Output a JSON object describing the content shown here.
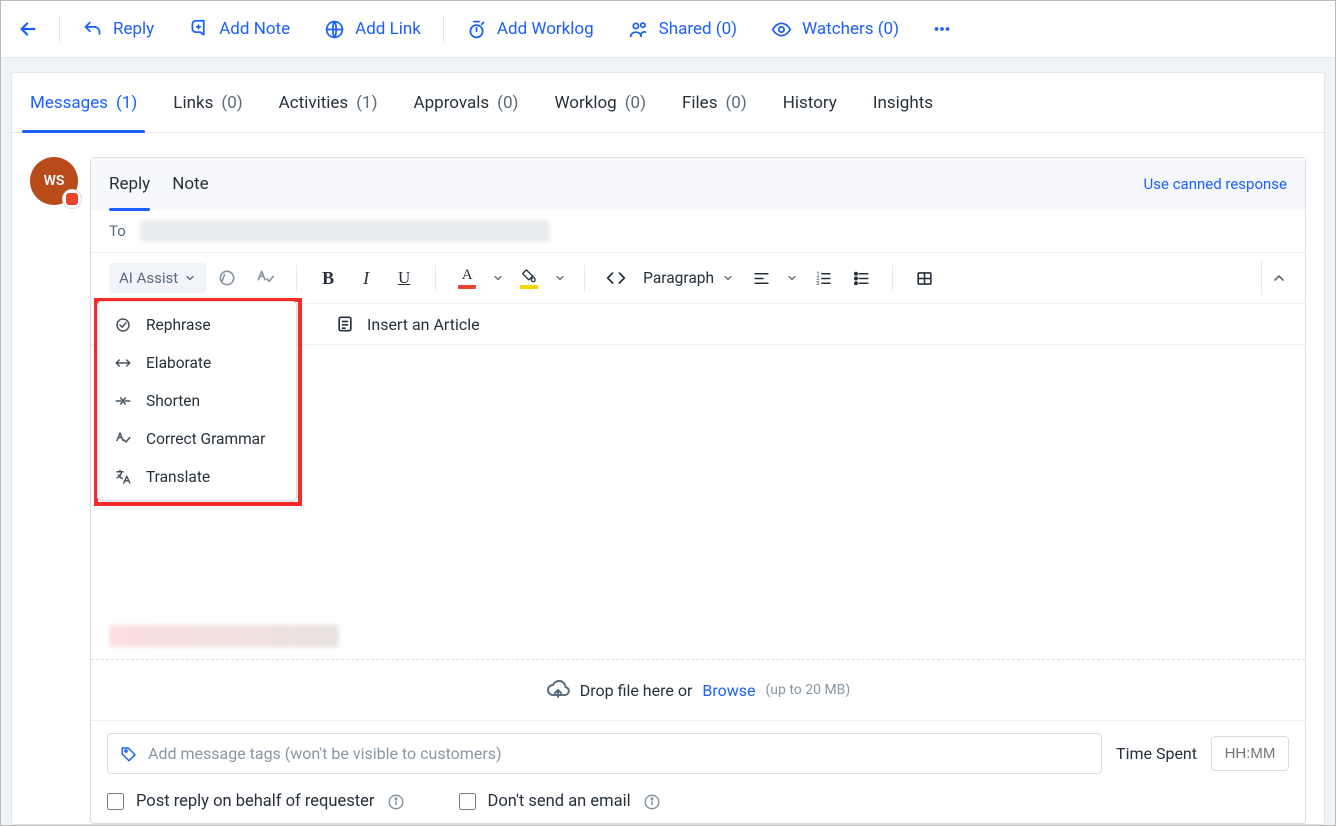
{
  "topbar": {
    "reply": "Reply",
    "add_note": "Add Note",
    "add_link": "Add Link",
    "add_worklog": "Add Worklog",
    "shared": "Shared (0)",
    "watchers": "Watchers (0)"
  },
  "tabs": [
    {
      "label": "Messages",
      "count": "(1)",
      "active": true
    },
    {
      "label": "Links",
      "count": "(0)"
    },
    {
      "label": "Activities",
      "count": "(1)"
    },
    {
      "label": "Approvals",
      "count": "(0)"
    },
    {
      "label": "Worklog",
      "count": "(0)"
    },
    {
      "label": "Files",
      "count": "(0)"
    },
    {
      "label": "History",
      "count": ""
    },
    {
      "label": "Insights",
      "count": ""
    }
  ],
  "avatar": {
    "initials": "WS"
  },
  "editor": {
    "mode_reply": "Reply",
    "mode_note": "Note",
    "canned_link": "Use canned response",
    "to_label": "To",
    "ai_label": "AI Assist",
    "paragraph_label": "Paragraph",
    "insert_article": "Insert an Article",
    "ai_menu": [
      "Rephrase",
      "Elaborate",
      "Shorten",
      "Correct Grammar",
      "Translate"
    ],
    "dropzone": {
      "text": "Drop file here or",
      "browse": "Browse",
      "hint": "(up to 20 MB)"
    },
    "tags_placeholder": "Add message tags (won't be visible to customers)",
    "time_label": "Time Spent",
    "time_placeholder": "HH:MM",
    "chk_behalf": "Post reply on behalf of requester",
    "chk_noemail": "Don't send an email"
  }
}
